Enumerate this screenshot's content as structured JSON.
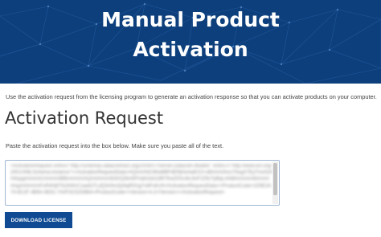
{
  "hero": {
    "title_line1": "Manual Product",
    "title_line2": "Activation",
    "background_color": "#0d3f7c"
  },
  "intro_text": "Use the activation request from the licensing program to generate an activation response so that you can activate products on your computer.",
  "section_title": "Activation Request",
  "instruction_text": "Paste the activation request into the box below. Make sure you paste all of the text.",
  "request_box": {
    "value": "<ActivationRequest xmlns=\"http://schemas.datacontract.org/2004/07/Server.Datacom.Models\" xmlns:i=\"http://www.w3.org/2001/XMLSchema-instance\"><ActivationRequestData>AQAAANCMnd8BFdERjHoAwE/Cl+sBAAAAhsU7bxgX7EyTmv0z9H4zpgAAAAACAAAAABBmAAAAAQAAIAAAAE8XQ3lm5PVqN1bA2dR7KwZ0Xc4rL6vF2Z9cTyBqLmN8AAAAAA6AAAAAAgAAIAAAAFxR4Hj0Tb2kWvC1ae8J7LdQ3n5mZpNqR0UgYs6FoKc9</ActivationRequestData><ProductCode>1D5E3A74-8C2F-4B9A-9E61-7A0F3C52D8B4</ProductCode><Version>4.2</Version></ActivationRequest>"
  },
  "buttons": {
    "download_label": "DOWNLOAD LICENSE",
    "download_color": "#0f4a93"
  }
}
